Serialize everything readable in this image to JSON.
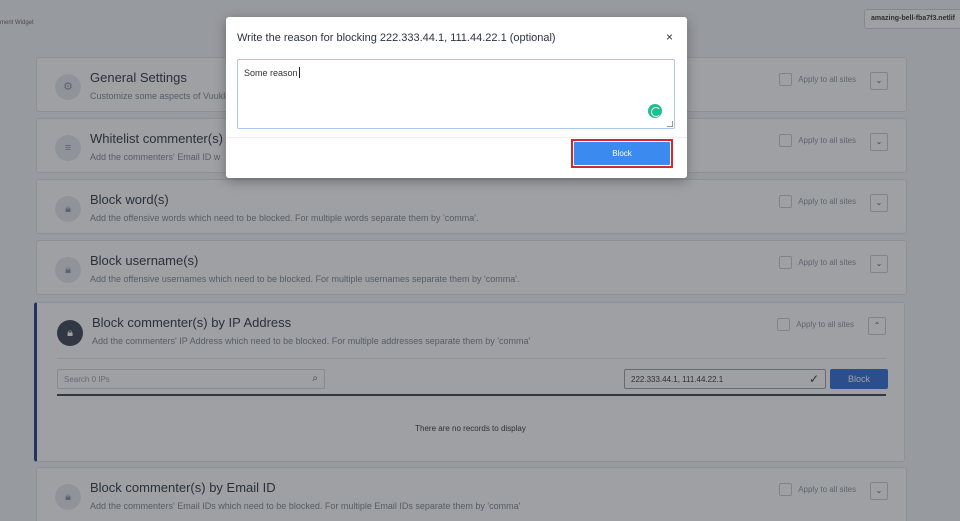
{
  "topbar": {
    "breadcrumb": "ment Widget",
    "site_label": "amazing-bell-fba7f3.netlif"
  },
  "cards": [
    {
      "title": "General Settings",
      "desc": "Customize some aspects of Vuukle",
      "apply": "Apply to all sites",
      "icon": "gear-icon"
    },
    {
      "title": "Whitelist commenter(s) b",
      "desc": "Add the commenters' Email ID w",
      "apply": "Apply to all sites",
      "icon": "list-icon"
    },
    {
      "title": "Block word(s)",
      "desc": "Add the offensive words which need to be blocked. For multiple words separate them by 'comma'.",
      "apply": "Apply to all sites",
      "icon": "lock-icon"
    },
    {
      "title": "Block username(s)",
      "desc": "Add the offensive usernames which need to be blocked. For multiple usernames separate them by 'comma'.",
      "apply": "Apply to all sites",
      "icon": "lock-icon"
    },
    {
      "title": "Block commenter(s) by IP Address",
      "desc": "Add the commenters' IP Address which need to be blocked. For multiple addresses separate them by 'comma'",
      "apply": "Apply to all sites",
      "icon": "lock-icon"
    },
    {
      "title": "Block commenter(s) by Email ID",
      "desc": "Add the commenters' Email IDs which need to be blocked. For multiple Email IDs separate them by 'comma'",
      "apply": "Apply to all sites",
      "icon": "lock-icon"
    }
  ],
  "ip_section": {
    "search_placeholder": "Search 0 IPs",
    "ip_value": "222.333.44.1, 111.44.22.1",
    "block_label": "Block",
    "empty_text": "There are no records to display"
  },
  "modal": {
    "title": "Write the reason for blocking 222.333.44.1, 111.44.22.1 (optional)",
    "reason_text": "Some reason",
    "close_glyph": "×",
    "block_label": "Block"
  },
  "colors": {
    "accent": "#3b8af0",
    "highlight": "#d9262c",
    "ip_block": "#2f6bd8"
  }
}
